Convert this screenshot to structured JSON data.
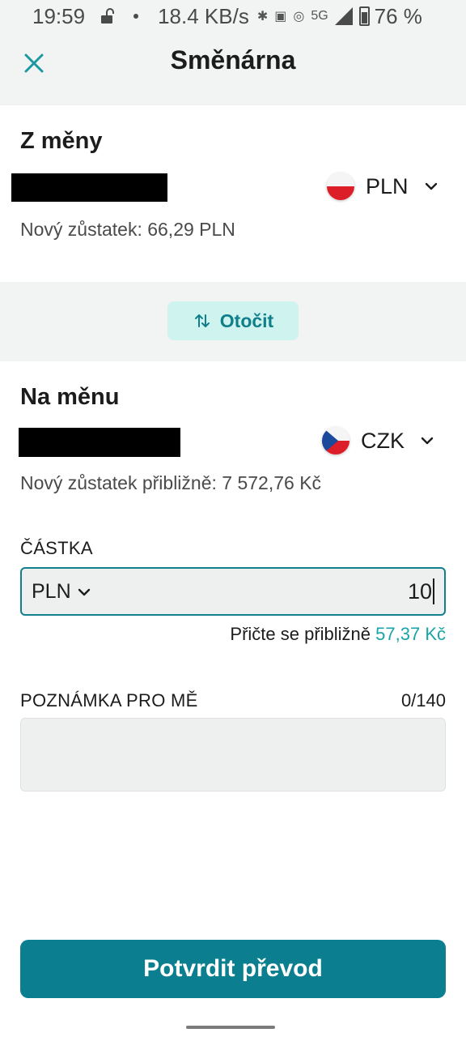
{
  "status_bar": {
    "time": "19:59",
    "net_speed": "18.4 KB/s",
    "network_type": "5G",
    "battery": "76 %"
  },
  "header": {
    "title": "Směnárna"
  },
  "from": {
    "title": "Z měny",
    "currency": "PLN",
    "balance_text": "Nový zůstatek: 66,29 PLN"
  },
  "swap": {
    "label": "Otočit"
  },
  "to": {
    "title": "Na měnu",
    "currency": "CZK",
    "balance_text": "Nový zůstatek přibližně: 7 572,76 Kč"
  },
  "amount": {
    "label": "ČÁSTKA",
    "currency": "PLN",
    "value": "10",
    "estimate_prefix": "Přičte se přibližně",
    "estimate_value": "57,37 Kč"
  },
  "note": {
    "label": "POZNÁMKA PRO MĚ",
    "counter": "0/140",
    "value": ""
  },
  "footer": {
    "confirm_label": "Potvrdit převod"
  },
  "colors": {
    "accent": "#0b7f90",
    "accent_light": "#cff3ef",
    "estimate_accent": "#1aa4a8",
    "background_gray": "#f2f3f3"
  }
}
